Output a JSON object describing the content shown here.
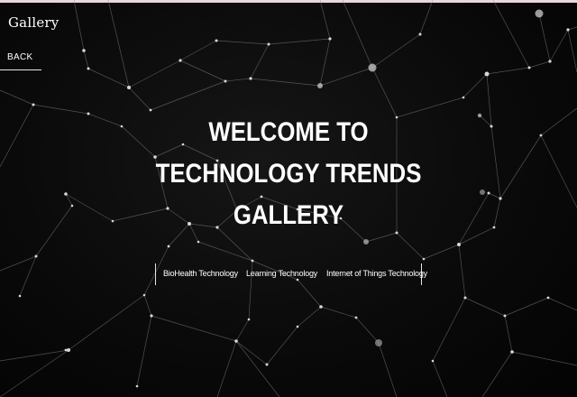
{
  "header": {
    "brand": "Gallery",
    "back_label": "BACK"
  },
  "hero": {
    "title_lines": [
      "WELCOME TO",
      "TECHNOLOGY TRENDS",
      "GALLERY"
    ]
  },
  "nav": {
    "links": [
      "BioHealth Technology",
      "Learning Technology",
      "Internet of Things Technology"
    ]
  },
  "colors": {
    "background": "#050505",
    "text": "#ffffff",
    "top_rule": "#ead7de",
    "network_line": "#9a9a9a"
  },
  "background_image": {
    "icon": "network-mesh-background"
  }
}
